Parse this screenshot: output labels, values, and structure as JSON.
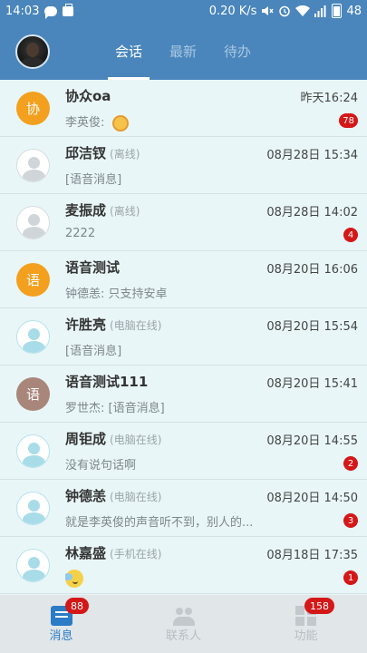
{
  "status_bar": {
    "time": "14:03",
    "network_speed": "0.20 K/s",
    "battery": "48",
    "icons": [
      "chat-bubble-icon",
      "bag-icon",
      "mute-icon",
      "alarm-icon",
      "wifi-icon",
      "signal-icon",
      "battery-icon"
    ]
  },
  "header": {
    "tabs": [
      {
        "label": "会话",
        "active": true
      },
      {
        "label": "最新",
        "active": false
      },
      {
        "label": "待办",
        "active": false
      }
    ]
  },
  "conversations": [
    {
      "name": "协众oa",
      "status": "",
      "time": "昨天16:24",
      "preview": "李英俊: ",
      "badge": "78",
      "avatar_text": "协",
      "avatar_style": "orange"
    },
    {
      "name": "邱洁钗",
      "status": "(离线)",
      "time": "08月28日 15:34",
      "preview": "[语音消息]",
      "badge": "",
      "avatar_text": "",
      "avatar_style": "gray"
    },
    {
      "name": "麦振成",
      "status": "(离线)",
      "time": "08月28日 14:02",
      "preview": "2222",
      "badge": "4",
      "avatar_text": "",
      "avatar_style": "gray"
    },
    {
      "name": "语音测试",
      "status": "",
      "time": "08月20日 16:06",
      "preview": "钟德恙: 只支持安卓",
      "badge": "",
      "avatar_text": "语",
      "avatar_style": "orange"
    },
    {
      "name": "许胜亮",
      "status": "(电脑在线)",
      "time": "08月20日 15:54",
      "preview": "[语音消息]",
      "badge": "",
      "avatar_text": "",
      "avatar_style": "blue"
    },
    {
      "name": "语音测试111",
      "status": "",
      "time": "08月20日 15:41",
      "preview": "罗世杰: [语音消息]",
      "badge": "",
      "avatar_text": "语",
      "avatar_style": "brown"
    },
    {
      "name": "周钜成",
      "status": "(电脑在线)",
      "time": "08月20日 14:55",
      "preview": "没有说句话啊",
      "badge": "2",
      "avatar_text": "",
      "avatar_style": "blue"
    },
    {
      "name": "钟德恙",
      "status": "(电脑在线)",
      "time": "08月20日 14:50",
      "preview": "就是李英俊的声音听不到，别人的...",
      "badge": "3",
      "avatar_text": "",
      "avatar_style": "blue"
    },
    {
      "name": "林嘉盛",
      "status": "(手机在线)",
      "time": "08月18日 17:35",
      "preview": "",
      "badge": "1",
      "avatar_text": "",
      "avatar_style": "blue"
    }
  ],
  "bottom_nav": [
    {
      "label": "消息",
      "badge": "88",
      "active": true,
      "icon": "message-icon"
    },
    {
      "label": "联系人",
      "badge": "",
      "active": false,
      "icon": "contacts-icon"
    },
    {
      "label": "功能",
      "badge": "158",
      "active": false,
      "icon": "apps-icon"
    }
  ],
  "colors": {
    "primary": "#4a86bc",
    "badge": "#d41818",
    "list_bg": "#e9f6f7",
    "active_nav": "#2b7bc6"
  }
}
